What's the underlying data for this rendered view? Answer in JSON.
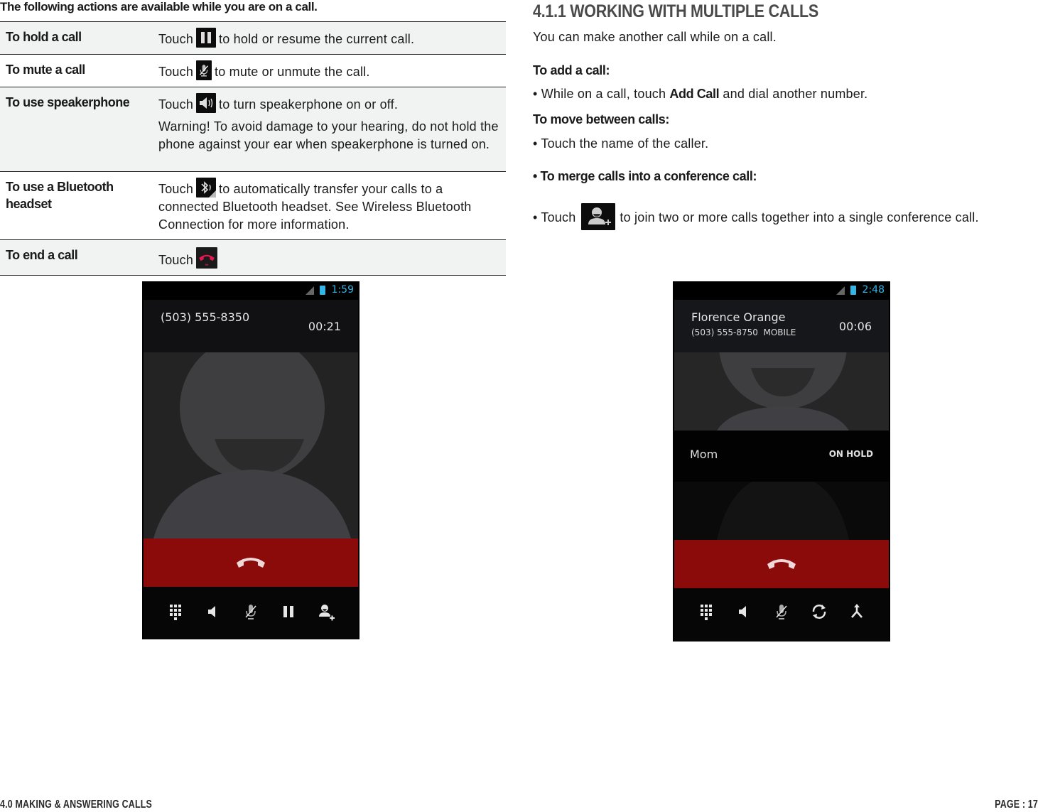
{
  "left": {
    "intro": "The following actions are available while you are on a call.",
    "rows": [
      {
        "label": "To hold a call",
        "touch": "Touch",
        "icon": "pause-icon",
        "text": "to hold or resume the current call.",
        "warning": ""
      },
      {
        "label": "To mute a call",
        "touch": "Touch",
        "icon": "mute-microphone-icon",
        "text": "to mute or unmute the call.",
        "warning": ""
      },
      {
        "label": "To use speakerphone",
        "touch": "Touch",
        "icon": "speaker-icon",
        "text": "to turn speakerphone on or off.",
        "warning": "Warning! To avoid damage to your hearing, do not hold the phone against your ear when speakerphone is turned on."
      },
      {
        "label": "To use a Bluetooth headset",
        "touch": "Touch",
        "icon": "bluetooth-audio-icon",
        "text": "to automatically transfer your calls to a connected Bluetooth headset. See Wireless Bluetooth Connection for more information.",
        "warning": ""
      },
      {
        "label": "To end a call",
        "touch": "Touch",
        "icon": "end-call-icon",
        "text": "",
        "warning": ""
      }
    ]
  },
  "right": {
    "heading": "4.1.1 WORKING WITH MULTIPLE CALLS",
    "intro": "You can make another call while on a call.",
    "add_call": {
      "title": "To add a call:",
      "bullet_prefix": "• While on a call, touch ",
      "bullet_bold": "Add Call",
      "bullet_suffix": " and dial another number."
    },
    "move_calls": {
      "title": "To move between calls:",
      "bullet": "• Touch the name of the caller."
    },
    "merge_calls": {
      "title": "• To merge calls into a conference call:",
      "bullet_prefix": "• Touch",
      "icon": "add-person-icon",
      "bullet_suffix": "to join two or more calls together into a single conference call."
    }
  },
  "phone1": {
    "status_time": "1:59",
    "number": "(503) 555-8350",
    "elapsed": "00:21",
    "controls": [
      "dialpad-icon",
      "speaker-icon",
      "mute-microphone-icon",
      "pause-icon",
      "add-person-icon"
    ]
  },
  "phone2": {
    "status_time": "2:48",
    "name": "Florence Orange",
    "number": "(503) 555-8750",
    "number_type": "MOBILE",
    "elapsed": "00:06",
    "hold_name": "Mom",
    "hold_status": "ON HOLD",
    "controls": [
      "dialpad-icon",
      "speaker-icon",
      "mute-microphone-icon",
      "swap-calls-icon",
      "merge-calls-icon"
    ]
  },
  "colors": {
    "end_call_red": "#8b0b0b",
    "status_blue": "#33b5e5",
    "end_icon_pink": "#e8174f"
  },
  "footer": {
    "section": "4.0 MAKING & ANSWERING CALLS",
    "page": "PAGE : 17"
  }
}
